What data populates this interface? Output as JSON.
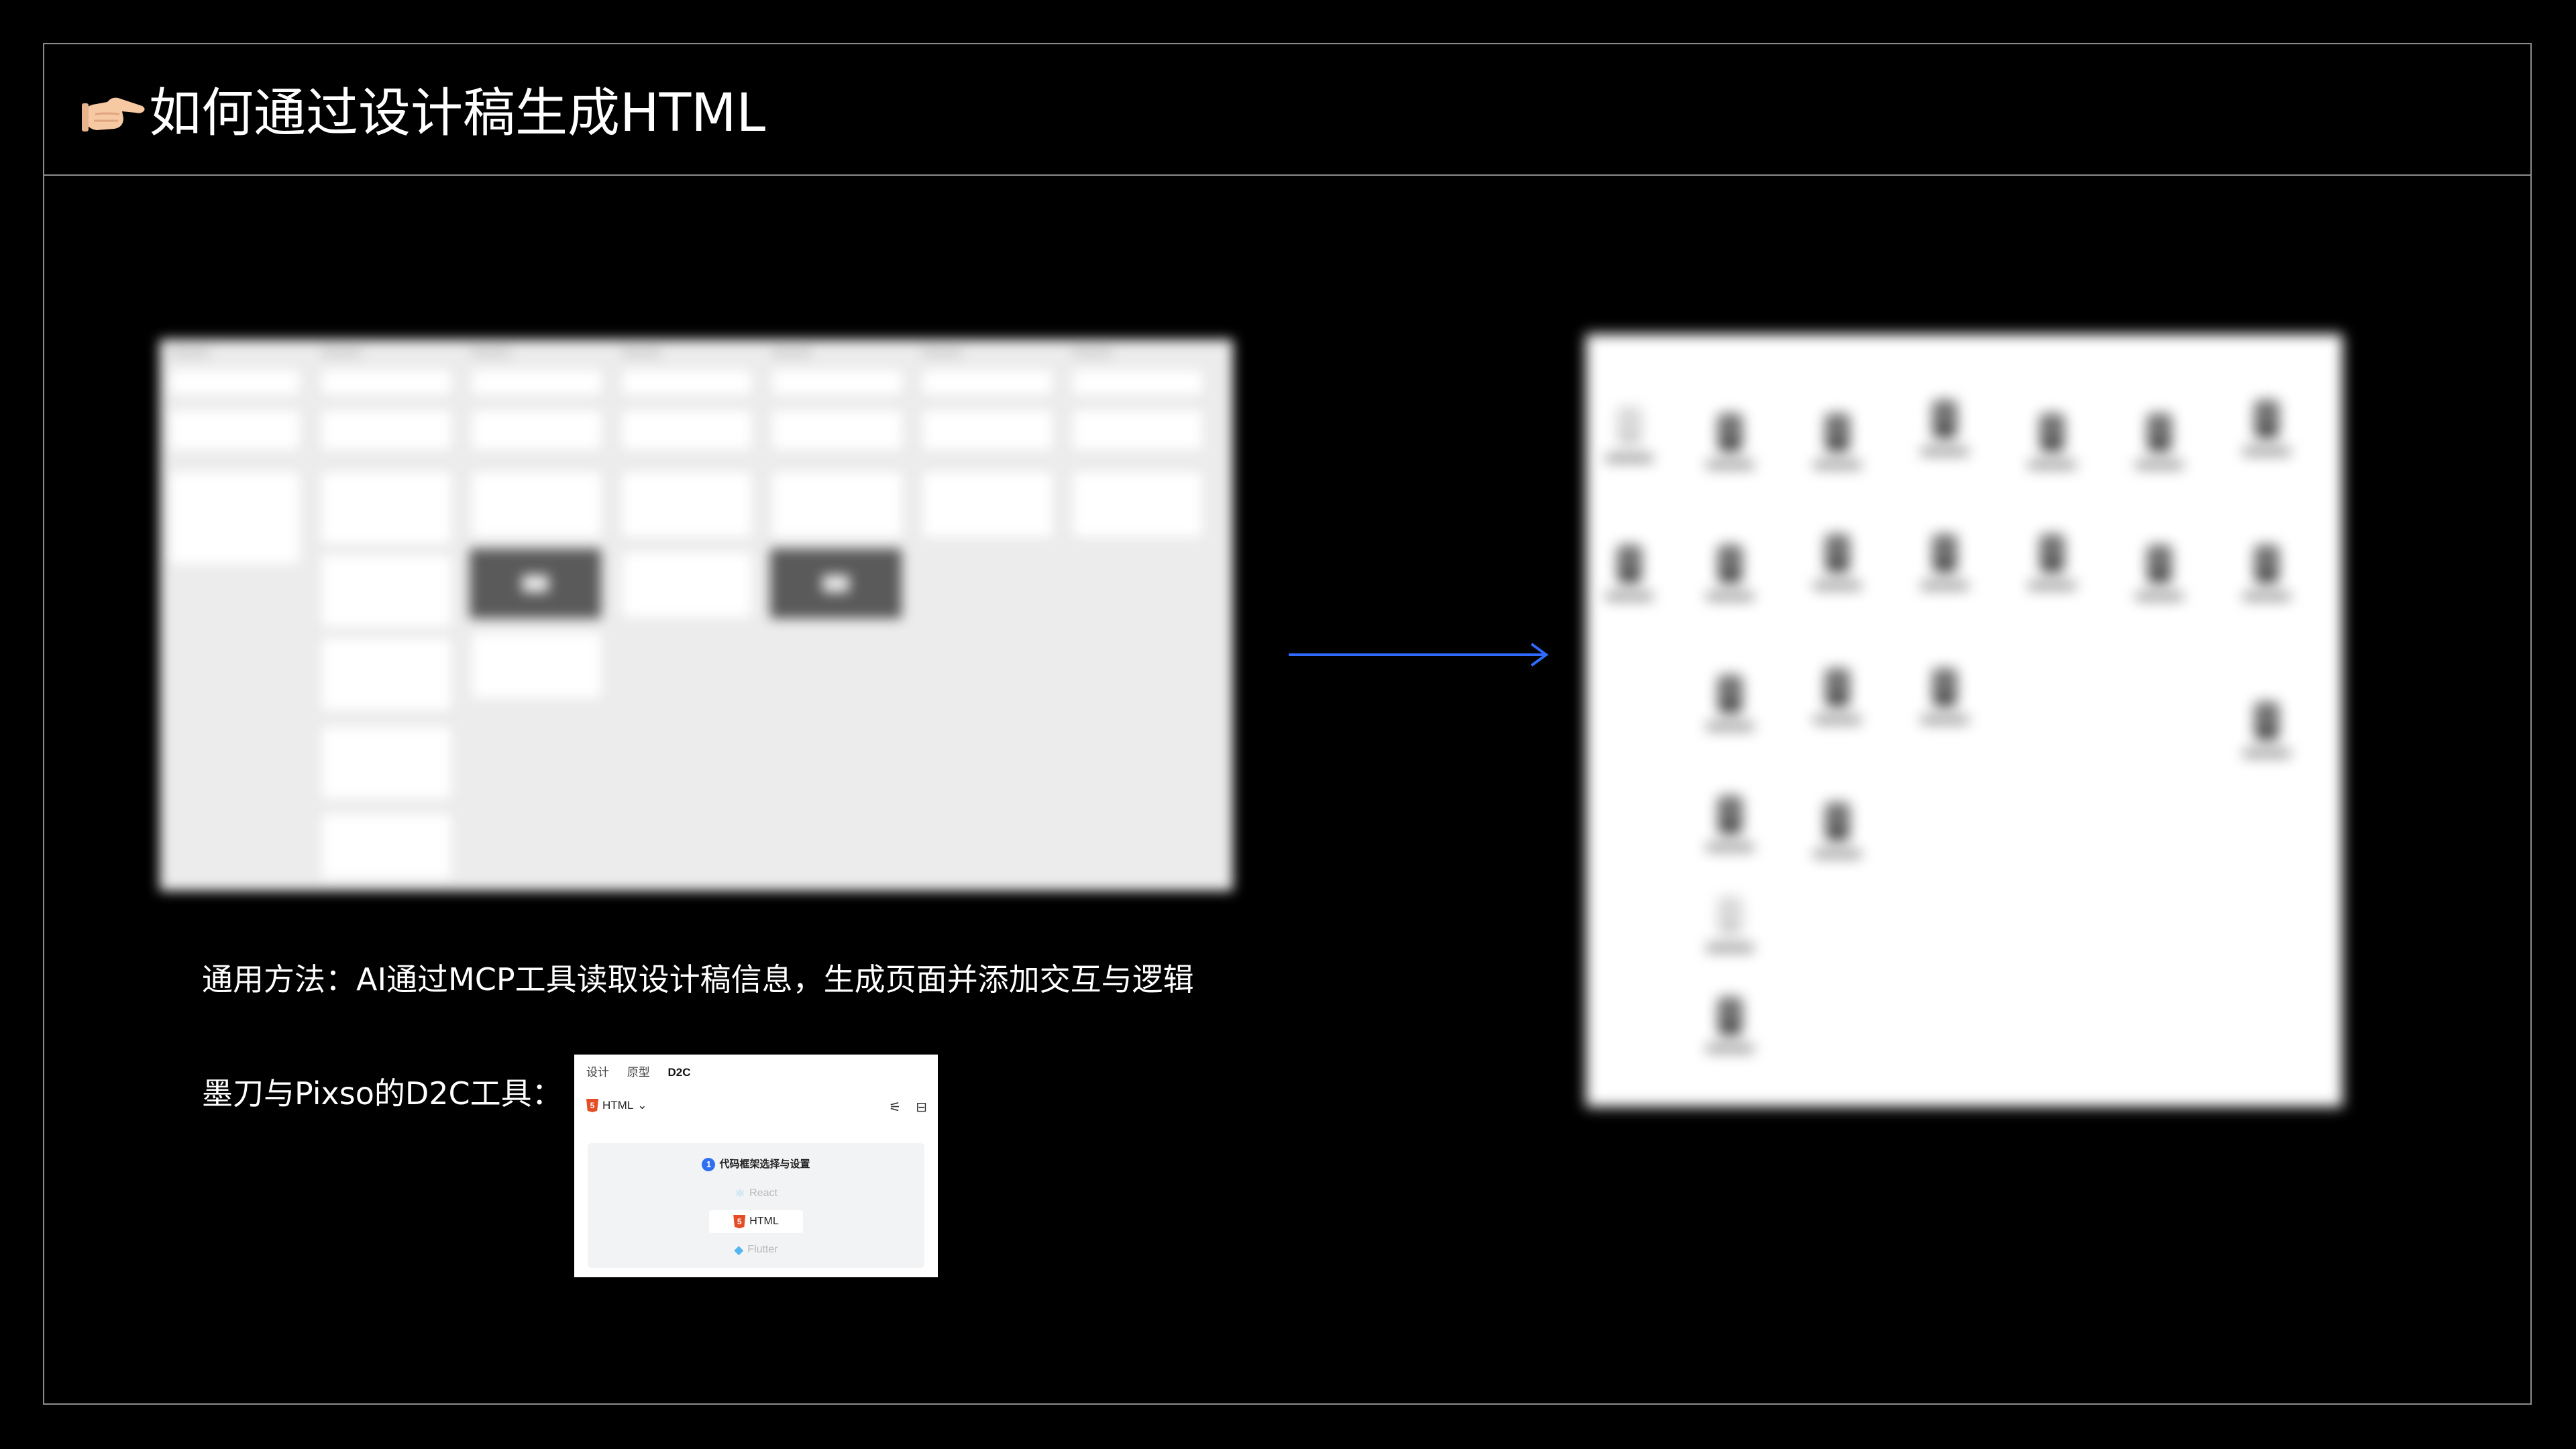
{
  "title": {
    "icon": "pointing-hand-icon",
    "text": "如何通过设计稿生成HTML"
  },
  "caption_method": "通用方法：AI通过MCP工具读取设计稿信息，生成页面并添加交互与逻辑",
  "caption_tools": "墨刀与Pixso的D2C工具：",
  "arrow": {
    "icon": "right-arrow-icon",
    "color": "#2f6bff"
  },
  "d2c_panel": {
    "tabs": [
      "设计",
      "原型",
      "D2C"
    ],
    "active_tab": "D2C",
    "framework_label": "HTML",
    "step_number": "1",
    "step_title": "代码框架选择与设置",
    "options": [
      "React",
      "HTML",
      "Flutter"
    ],
    "selected_option": "HTML"
  },
  "colors": {
    "background": "#000000",
    "border": "#8c8c8c",
    "accent": "#2f6bff",
    "html5": "#e44d26"
  }
}
